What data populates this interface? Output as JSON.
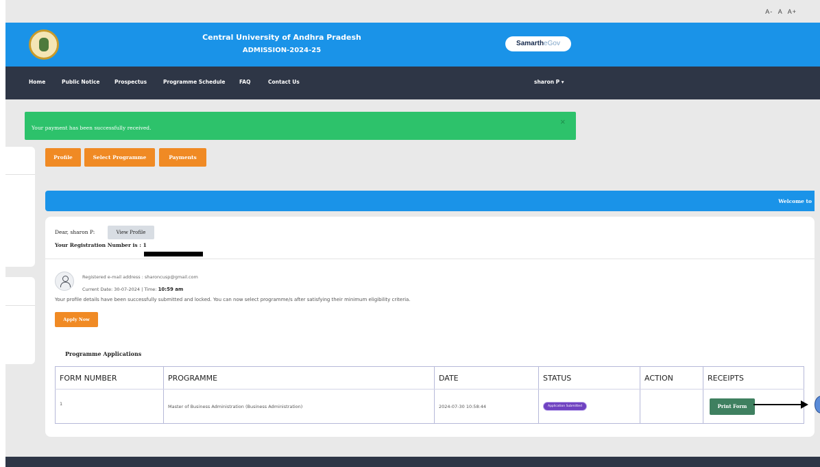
{
  "font_controls": [
    "A-",
    "A",
    "A+"
  ],
  "header": {
    "university": "Central University of Andhra Pradesh",
    "admission": "ADMISSION-2024-25",
    "brand_main": "Samarth",
    "brand_sub": "eGov",
    "color": "#1a93e8"
  },
  "nav": {
    "items": [
      "Home",
      "Public Notice",
      "Prospectus",
      "Programme Schedule",
      "FAQ",
      "Contact Us"
    ],
    "user": "sharon P ▾",
    "color": "#2e3646"
  },
  "alert": {
    "message": "Your payment has been successfully received.",
    "close": "×",
    "color": "#2dc26b"
  },
  "tabs": [
    "Profile",
    "Select Programme",
    "Payments"
  ],
  "welcome": "Welcome to",
  "profile": {
    "dear": "Dear, sharon P:",
    "view_profile": "View Profile",
    "registration": "Your Registration Number is : 1",
    "email_line": "Registered e-mail address : sharoncusp@gmail.com",
    "date_prefix": "Current Date: ",
    "date": "30-07-2024",
    "time_prefix": " | Time: ",
    "time": "10:59 am",
    "locked_message": "Your profile details have been successfully submitted and locked. You can now select programme/s after satisfying their minimum eligibility criteria.",
    "apply_now": "Apply Now"
  },
  "applications": {
    "title": "Programme Applications",
    "columns": [
      "FORM NUMBER",
      "PROGRAMME",
      "DATE",
      "STATUS",
      "ACTION",
      "RECEIPTS"
    ],
    "rows": [
      {
        "form_number": "1",
        "programme": "Master of Business Administration (Business Administration)",
        "date": "2024-07-30 10:58:44",
        "status": "Application Submitted",
        "action": "",
        "receipt_button": "Print Form"
      }
    ]
  },
  "accent_color": "#f08a24"
}
